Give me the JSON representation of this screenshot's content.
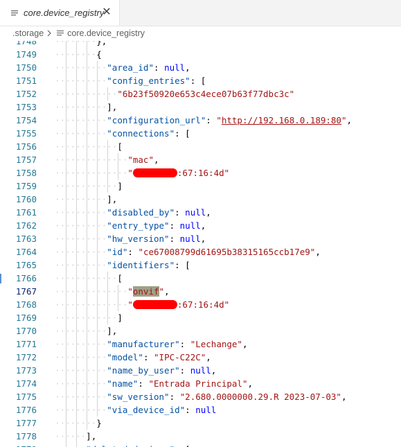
{
  "tab": {
    "title": "core.device_registry",
    "close_glyph": "✕"
  },
  "breadcrumb": {
    "folder": ".storage",
    "file": "core.device_registry"
  },
  "colors": {
    "key": "#0451a5",
    "string": "#a31515",
    "null": "#0000ff",
    "redaction": "#ff0000",
    "line_number": "#237893"
  },
  "editor": {
    "active_line": "1767",
    "lines": [
      {
        "num": "1748",
        "text": "        },",
        "indent": 8
      },
      {
        "num": "1749",
        "text": "        {",
        "indent": 8
      },
      {
        "num": "1750",
        "text": "          \"area_id\": null,",
        "indent": 10
      },
      {
        "num": "1751",
        "text": "          \"config_entries\": [",
        "indent": 10
      },
      {
        "num": "1752",
        "text": "            \"6b23f50920e653c4ece07b63f77dbc3c\"",
        "indent": 12
      },
      {
        "num": "1753",
        "text": "          ],",
        "indent": 10
      },
      {
        "num": "1754",
        "text": "          \"configuration_url\": \"http://192.168.0.189:80\",",
        "indent": 10
      },
      {
        "num": "1755",
        "text": "          \"connections\": [",
        "indent": 10
      },
      {
        "num": "1756",
        "text": "            [",
        "indent": 12
      },
      {
        "num": "1757",
        "text": "              \"mac\",",
        "indent": 14
      },
      {
        "num": "1758",
        "text": "              \"█:67:16:4d\"",
        "indent": 14
      },
      {
        "num": "1759",
        "text": "            ]",
        "indent": 12
      },
      {
        "num": "1760",
        "text": "          ],",
        "indent": 10
      },
      {
        "num": "1761",
        "text": "          \"disabled_by\": null,",
        "indent": 10
      },
      {
        "num": "1762",
        "text": "          \"entry_type\": null,",
        "indent": 10
      },
      {
        "num": "1763",
        "text": "          \"hw_version\": null,",
        "indent": 10
      },
      {
        "num": "1764",
        "text": "          \"id\": \"ce67008799d61695b38315165ccb17e9\",",
        "indent": 10
      },
      {
        "num": "1765",
        "text": "          \"identifiers\": [",
        "indent": 10
      },
      {
        "num": "1766",
        "text": "            [",
        "indent": 12
      },
      {
        "num": "1767",
        "text": "              \"onvif\",",
        "indent": 14
      },
      {
        "num": "1768",
        "text": "              \"█:67:16:4d\"",
        "indent": 14
      },
      {
        "num": "1769",
        "text": "            ]",
        "indent": 12
      },
      {
        "num": "1770",
        "text": "          ],",
        "indent": 10
      },
      {
        "num": "1771",
        "text": "          \"manufacturer\": \"Lechange\",",
        "indent": 10
      },
      {
        "num": "1772",
        "text": "          \"model\": \"IPC-C22C\",",
        "indent": 10
      },
      {
        "num": "1773",
        "text": "          \"name_by_user\": null,",
        "indent": 10
      },
      {
        "num": "1774",
        "text": "          \"name\": \"Entrada Principal\",",
        "indent": 10
      },
      {
        "num": "1775",
        "text": "          \"sw_version\": \"2.680.0000000.29.R 2023-07-03\",",
        "indent": 10
      },
      {
        "num": "1776",
        "text": "          \"via_device_id\": null",
        "indent": 10
      },
      {
        "num": "1777",
        "text": "        }",
        "indent": 8
      },
      {
        "num": "1778",
        "text": "      ],",
        "indent": 6
      },
      {
        "num": "1779",
        "text": "      \"deleted_devices\": [",
        "indent": 6
      }
    ]
  }
}
